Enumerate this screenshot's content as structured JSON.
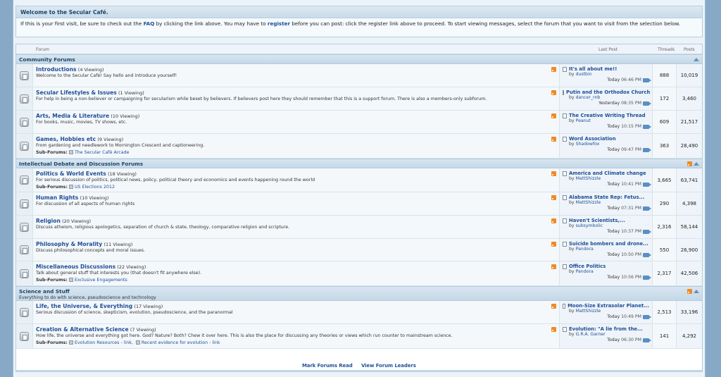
{
  "welcome": {
    "title": "Welcome to the Secular Café.",
    "text_1": "If this is your first visit, be sure to check out the ",
    "faq_link": "FAQ",
    "text_2": " by clicking the link above. You may have to ",
    "register_link": "register",
    "text_3": " before you can post: click the register link above to proceed. To start viewing messages, select the forum that you want to visit from the selection below."
  },
  "columns": {
    "forum": "Forum",
    "last_post": "Last Post",
    "threads": "Threads",
    "posts": "Posts"
  },
  "labels": {
    "sub_forums": "Sub-Forums:"
  },
  "categories": [
    {
      "title": "Community Forums",
      "forums": [
        {
          "title": "Introductions",
          "viewing": "(4 Viewing)",
          "desc": "Welcome to the Secular Café! Say hello and introduce yourself!",
          "last_title": "It's all about me!!",
          "last_by": "dustbin",
          "last_when": "Today",
          "last_time": "06:46 PM",
          "threads": "888",
          "posts": "10,019"
        },
        {
          "title": "Secular Lifestyles & Issues",
          "viewing": "(1 Viewing)",
          "desc": "For help in being a non-believer or campaigning for secularism while beset by believers. If believers post here they should remember that this is a support forum. There is also a members-only subforum.",
          "last_title": "Putin and the Orthodox Church",
          "last_by": "dancer_rnb",
          "last_when": "Yesterday",
          "last_time": "08:35 PM",
          "threads": "172",
          "posts": "3,460"
        },
        {
          "title": "Arts, Media & Literature",
          "viewing": "(10 Viewing)",
          "desc": "For books, music, movies, TV shows, etc.",
          "last_title": "The Creative Writing Thread",
          "last_by": "Peanut",
          "last_when": "Today",
          "last_time": "10:15 PM",
          "threads": "609",
          "posts": "21,517"
        },
        {
          "title": "Games, Hobbies etc",
          "viewing": "(9 Viewing)",
          "desc": "From gardening and needlework to Mornington Crescent and captioneering.",
          "subs": "The Secular Café Arcade",
          "last_title": "Word Association",
          "last_by": "Shadowfox",
          "last_when": "Today",
          "last_time": "09:47 PM",
          "threads": "363",
          "posts": "28,490"
        }
      ]
    },
    {
      "title": "Intellectual Debate and Discussion Forums",
      "forums": [
        {
          "title": "Politics & World Events",
          "viewing": "(18 Viewing)",
          "desc": "For serious discussion of politics, political news, policy, political theory and economics and events happening round the world",
          "subs": "US Elections 2012",
          "last_title": "America and Climate change",
          "last_by": "MattShizzle",
          "last_when": "Today",
          "last_time": "10:41 PM",
          "threads": "3,665",
          "posts": "63,741"
        },
        {
          "title": "Human Rights",
          "viewing": "(10 Viewing)",
          "desc": "For discussion of all aspects of human rights",
          "last_title": "Alabama State Rep: Fetus...",
          "last_by": "MattShizzle",
          "last_when": "Today",
          "last_time": "07:31 PM",
          "threads": "290",
          "posts": "4,398"
        },
        {
          "title": "Religion",
          "viewing": "(20 Viewing)",
          "desc": "Discuss atheism, religious apologetics, separation of church & state, theology, comparative religion and scripture.",
          "last_title": "Haven't Scientists,...",
          "last_by": "subsymbolic",
          "last_when": "Today",
          "last_time": "10:37 PM",
          "threads": "2,316",
          "posts": "58,144"
        },
        {
          "title": "Philosophy & Morality",
          "viewing": "(11 Viewing)",
          "desc": "Discuss philosophical concepts and moral issues.",
          "last_title": "Suicide bombers and drone...",
          "last_by": "Pandora",
          "last_when": "Today",
          "last_time": "10:50 PM",
          "threads": "550",
          "posts": "26,900"
        },
        {
          "title": "Miscellaneous Discussions",
          "viewing": "(22 Viewing)",
          "desc": "Talk about general stuff that interests you (that doesn't fit anywhere else).",
          "subs": "Exclusive Engagements",
          "last_title": "Office Politics",
          "last_by": "Pandora",
          "last_when": "Today",
          "last_time": "10:56 PM",
          "threads": "2,317",
          "posts": "42,506"
        }
      ]
    },
    {
      "title": "Science and Stuff",
      "desc": "Everything to do with science, pseudoscience and technology",
      "forums": [
        {
          "title": "Life, the Universe, & Everything",
          "viewing": "(17 Viewing)",
          "desc": "Serious discussion of science, skepticism, evolution, pseudoscience, and the paranormal",
          "last_title": "Moon-Size Extrasolar Planet...",
          "last_by": "MattShizzle",
          "last_when": "Today",
          "last_time": "10:49 PM",
          "threads": "2,513",
          "posts": "33,196"
        },
        {
          "title": "Creation & Alternative Science",
          "viewing": "(7 Viewing)",
          "desc": "How life, the universe and everything got here. God? Nature? Both? Chew it over here. This is also the place for discussing any theories or views which run counter to mainstream science.",
          "subs": "Evolution Resources - link,",
          "subs2": "Recent evidence for evolution - link",
          "last_title": "Evolution: \"A lie from the...",
          "last_by": "G.R.A. Garner",
          "last_when": "Today",
          "last_time": "06:30 PM",
          "threads": "141",
          "posts": "4,292"
        }
      ]
    }
  ],
  "footer": {
    "mark_read": "Mark Forums Read",
    "view_leaders": "View Forum Leaders"
  }
}
